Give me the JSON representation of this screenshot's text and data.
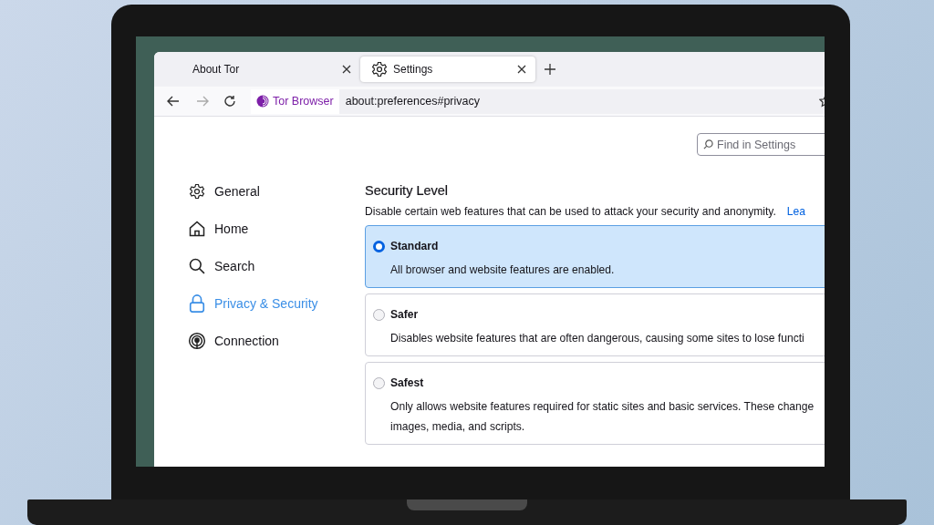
{
  "tabs": [
    {
      "label": "About Tor",
      "selected": false
    },
    {
      "label": "Settings",
      "selected": true,
      "kind": "gear"
    }
  ],
  "address_bar": {
    "identity": "Tor Browser",
    "url": "about:preferences#privacy"
  },
  "search": {
    "placeholder": "Find in Settings"
  },
  "sidebar": {
    "items": [
      {
        "label": "General",
        "kind": "gear",
        "selected": false
      },
      {
        "label": "Home",
        "kind": "home",
        "selected": false
      },
      {
        "label": "Search",
        "kind": "search",
        "selected": false
      },
      {
        "label": "Privacy & Security",
        "kind": "lock",
        "selected": true
      },
      {
        "label": "Connection",
        "kind": "signal",
        "selected": false
      }
    ]
  },
  "security_level": {
    "title": "Security Level",
    "description": "Disable certain web features that can be used to attack your security and anonymity.",
    "link": "Lea",
    "options": [
      {
        "label": "Standard",
        "selected": true,
        "description_lines": [
          "All browser and website features are enabled."
        ]
      },
      {
        "label": "Safer",
        "selected": false,
        "description_lines": [
          "Disables website features that are often dangerous, causing some sites to lose functi"
        ]
      },
      {
        "label": "Safest",
        "selected": false,
        "description_lines": [
          "Only allows website features required for static sites and basic services. These change",
          "images, media, and scripts."
        ]
      }
    ]
  }
}
